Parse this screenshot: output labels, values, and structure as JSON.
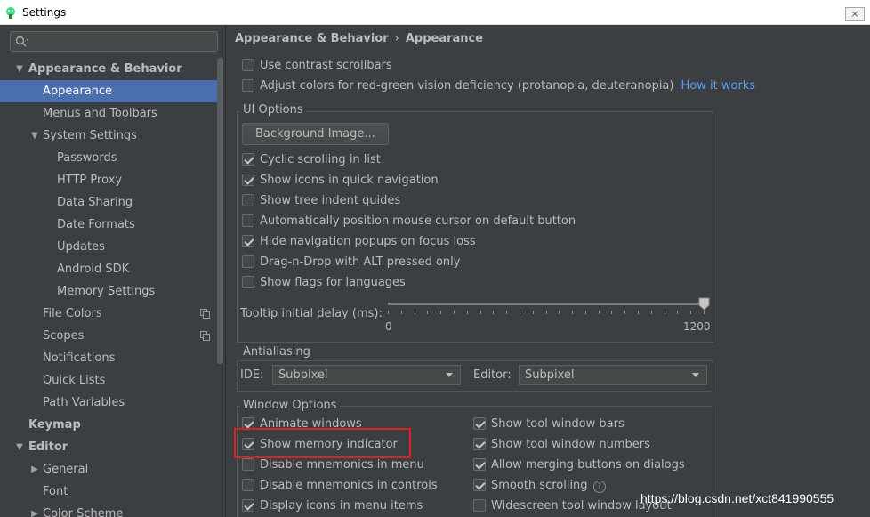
{
  "window": {
    "title": "Settings",
    "close_glyph": "×",
    "icons": {
      "app": "android-studio-icon",
      "close": "close-icon"
    }
  },
  "sidebar": {
    "search_placeholder": "",
    "search_icon": "search-icon",
    "items": [
      {
        "label": "Appearance & Behavior",
        "arrow": "▼"
      },
      {
        "label": "Appearance"
      },
      {
        "label": "Menus and Toolbars"
      },
      {
        "label": "System Settings",
        "arrow": "▼"
      },
      {
        "label": "Passwords"
      },
      {
        "label": "HTTP Proxy"
      },
      {
        "label": "Data Sharing"
      },
      {
        "label": "Date Formats"
      },
      {
        "label": "Updates"
      },
      {
        "label": "Android SDK"
      },
      {
        "label": "Memory Settings"
      },
      {
        "label": "File Colors",
        "icon": "project-scope-icon"
      },
      {
        "label": "Scopes",
        "icon": "project-scope-icon"
      },
      {
        "label": "Notifications"
      },
      {
        "label": "Quick Lists"
      },
      {
        "label": "Path Variables"
      },
      {
        "label": "Keymap"
      },
      {
        "label": "Editor",
        "arrow": "▼"
      },
      {
        "label": "General",
        "arrow": "▶"
      },
      {
        "label": "Font"
      },
      {
        "label": "Color Scheme",
        "arrow": "▶"
      }
    ]
  },
  "breadcrumb": {
    "parent": "Appearance & Behavior",
    "separator": "›",
    "current": "Appearance"
  },
  "top_options": [
    {
      "label": "Use contrast scrollbars",
      "checked": false
    },
    {
      "label": "Adjust colors for red-green vision deficiency (protanopia, deuteranopia)",
      "checked": false
    }
  ],
  "how_it_works": "How it works",
  "ui_options": {
    "title": "UI Options",
    "background_button": "Background Image...",
    "checkboxes": [
      {
        "label": "Cyclic scrolling in list",
        "checked": true
      },
      {
        "label": "Show icons in quick navigation",
        "checked": true
      },
      {
        "label": "Show tree indent guides",
        "checked": false
      },
      {
        "label": "Automatically position mouse cursor on default button",
        "checked": false
      },
      {
        "label": "Hide navigation popups on focus loss",
        "checked": true
      },
      {
        "label": "Drag-n-Drop with ALT pressed only",
        "checked": false
      },
      {
        "label": "Show flags for languages",
        "checked": false
      }
    ],
    "tooltip_label": "Tooltip initial delay (ms):",
    "tooltip_min": "0",
    "tooltip_max": "1200",
    "tooltip_value": 1200
  },
  "antialiasing": {
    "title": "Antialiasing",
    "ide_label": "IDE:",
    "ide_value": "Subpixel",
    "editor_label": "Editor:",
    "editor_value": "Subpixel"
  },
  "window_options": {
    "title": "Window Options",
    "left": [
      {
        "label": "Animate windows",
        "checked": true
      },
      {
        "label": "Show memory indicator",
        "checked": true
      },
      {
        "label": "Disable mnemonics in menu",
        "checked": false
      },
      {
        "label": "Disable mnemonics in controls",
        "checked": false
      },
      {
        "label": "Display icons in menu items",
        "checked": true
      }
    ],
    "right": [
      {
        "label": "Show tool window bars",
        "checked": true
      },
      {
        "label": "Show tool window numbers",
        "checked": true
      },
      {
        "label": "Allow merging buttons on dialogs",
        "checked": true
      },
      {
        "label": "Smooth scrolling",
        "checked": true,
        "help": "?"
      },
      {
        "label": "Widescreen tool window layout",
        "checked": false
      }
    ]
  },
  "watermark": "https://blog.csdn.net/xct841990555",
  "colors": {
    "background": "#3c3f41",
    "selection": "#4b6eaf",
    "link": "#589df6",
    "highlight": "#e02020"
  }
}
